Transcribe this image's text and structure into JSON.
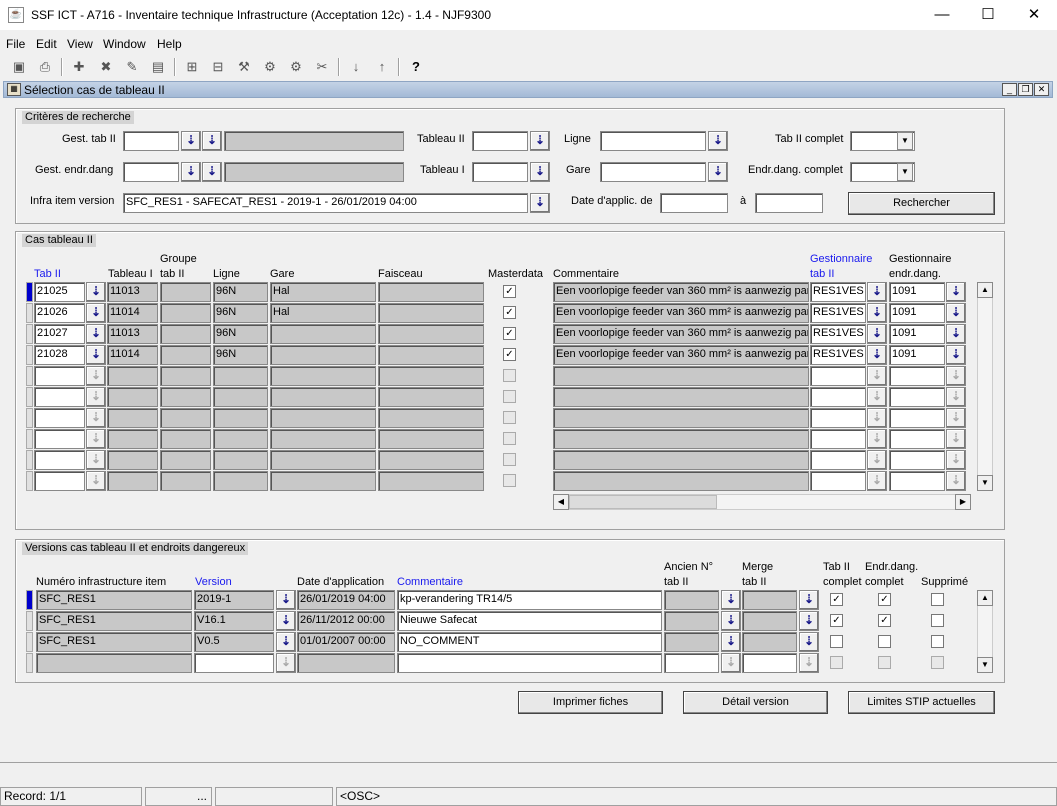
{
  "window": {
    "title": "SSF ICT - A716 - Inventaire technique Infrastructure (Acceptation 12c) - 1.4 - NJF9300"
  },
  "menu": [
    "File",
    "Edit",
    "View",
    "Window",
    "Help"
  ],
  "inner": {
    "title": "Sélection cas de tableau II"
  },
  "criteria": {
    "title": "Critères de recherche",
    "gest_tab_label": "Gest. tab II",
    "gest_endr_label": "Gest. endr.dang",
    "infra_label": "Infra item version",
    "infra_value": "SFC_RES1 - SAFECAT_RES1 - 2019-1 - 26/01/2019 04:00",
    "tableau2_label": "Tableau II",
    "tableau1_label": "Tableau I",
    "ligne_label": "Ligne",
    "gare_label": "Gare",
    "date_label": "Date d'applic. de",
    "a_label": "à",
    "tab2_complet_label": "Tab II complet",
    "endr_complet_label": "Endr.dang. complet",
    "search_button": "Rechercher"
  },
  "cas": {
    "title": "Cas tableau II",
    "headers": {
      "tab2": "Tab II",
      "tab1": "Tableau I",
      "groupe1": "Groupe",
      "groupe2": "tab II",
      "ligne": "Ligne",
      "gare": "Gare",
      "faisceau": "Faisceau",
      "master": "Masterdata",
      "comment": "Commentaire",
      "gest1": "Gestionnaire",
      "gest2": "tab II",
      "gendr1": "Gestionnaire",
      "gendr2": "endr.dang."
    },
    "rows": [
      {
        "tab2": "21025",
        "tab1": "11013",
        "groupe": "",
        "ligne": "96N",
        "gare": "Hal",
        "faisceau": "",
        "master": true,
        "comment": "Een voorlopige feeder van 360 mm² is aanwezig par",
        "gest": "RES1VES",
        "gendr": "1091"
      },
      {
        "tab2": "21026",
        "tab1": "11014",
        "groupe": "",
        "ligne": "96N",
        "gare": "Hal",
        "faisceau": "",
        "master": true,
        "comment": "Een voorlopige feeder van 360 mm² is aanwezig par",
        "gest": "RES1VES",
        "gendr": "1091"
      },
      {
        "tab2": "21027",
        "tab1": "11013",
        "groupe": "",
        "ligne": "96N",
        "gare": "",
        "faisceau": "",
        "master": true,
        "comment": "Een voorlopige feeder van 360 mm² is aanwezig par",
        "gest": "RES1VES",
        "gendr": "1091"
      },
      {
        "tab2": "21028",
        "tab1": "11014",
        "groupe": "",
        "ligne": "96N",
        "gare": "",
        "faisceau": "",
        "master": true,
        "comment": "Een voorlopige feeder van 360 mm² is aanwezig par",
        "gest": "RES1VES",
        "gendr": "1091"
      }
    ],
    "empty_rows": 6
  },
  "versions": {
    "title": "Versions cas tableau II et endroits dangereux",
    "headers": {
      "numero": "Numéro infrastructure item",
      "version": "Version",
      "date": "Date d'application",
      "comment": "Commentaire",
      "ancien1": "Ancien N°",
      "ancien2": "tab II",
      "merge1": "Merge",
      "merge2": "tab II",
      "tabc1": "Tab II",
      "tabc2": "complet",
      "endrc1": "Endr.dang.",
      "endrc2": "complet",
      "supprime": "Supprimé"
    },
    "rows": [
      {
        "numero": "SFC_RES1",
        "version": "2019-1",
        "date": "26/01/2019 04:00",
        "comment": "kp-verandering TR14/5",
        "ancien": "",
        "merge": "",
        "tabc": true,
        "endrc": true,
        "supp": false
      },
      {
        "numero": "SFC_RES1",
        "version": "V16.1",
        "date": "26/11/2012 00:00",
        "comment": "Nieuwe Safecat",
        "ancien": "",
        "merge": "",
        "tabc": true,
        "endrc": true,
        "supp": false
      },
      {
        "numero": "SFC_RES1",
        "version": "V0.5",
        "date": "01/01/2007 00:00",
        "comment": "NO_COMMENT",
        "ancien": "",
        "merge": "",
        "tabc": false,
        "endrc": false,
        "supp": false
      }
    ]
  },
  "buttons": {
    "print": "Imprimer fiches",
    "detail": "Détail version",
    "limits": "Limites STIP actuelles"
  },
  "status": {
    "record": "Record: 1/1",
    "dots": "...",
    "osc": "<OSC>"
  }
}
